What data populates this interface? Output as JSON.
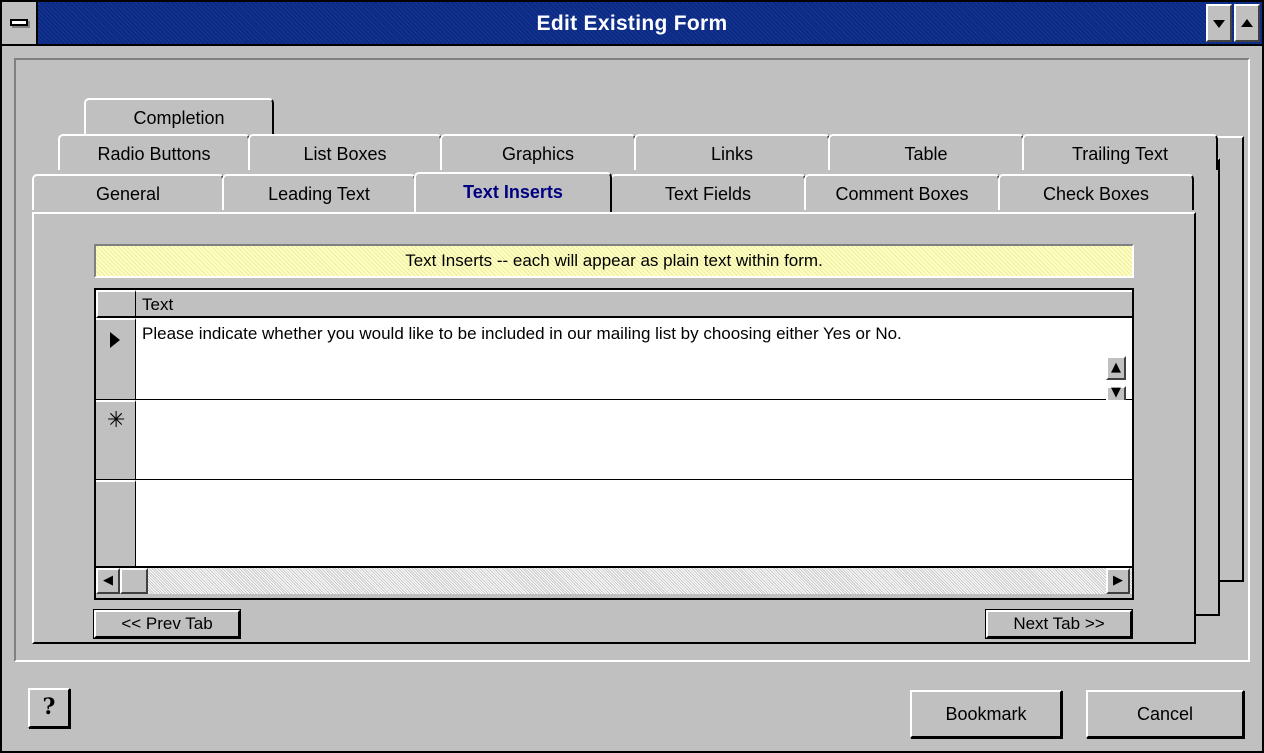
{
  "window": {
    "title": "Edit Existing Form"
  },
  "tabs": {
    "row1": [
      {
        "label": "Completion"
      }
    ],
    "row2": [
      {
        "label": "Radio Buttons"
      },
      {
        "label": "List Boxes"
      },
      {
        "label": "Graphics"
      },
      {
        "label": "Links"
      },
      {
        "label": "Table"
      },
      {
        "label": "Trailing Text"
      }
    ],
    "row3": [
      {
        "label": "General"
      },
      {
        "label": "Leading Text"
      },
      {
        "label": "Text Inserts",
        "active": true
      },
      {
        "label": "Text Fields"
      },
      {
        "label": "Comment Boxes"
      },
      {
        "label": "Check Boxes"
      }
    ]
  },
  "page": {
    "banner": "Text Inserts -- each will appear as plain text within form.",
    "grid": {
      "column_header": "Text",
      "rows": [
        {
          "marker": "current-record-icon",
          "text": "Please indicate whether you would like to be included in our mailing list by choosing either Yes or No."
        },
        {
          "marker": "new-record-icon",
          "marker_glyph": "✳",
          "text": ""
        },
        {
          "marker": "",
          "text": ""
        }
      ]
    },
    "prev_tab_label": "<< Prev Tab",
    "next_tab_label": "Next Tab >>"
  },
  "footer": {
    "help_glyph": "?",
    "bookmark_label": "Bookmark",
    "cancel_label": "Cancel"
  },
  "colors": {
    "titlebar": "#0a2a86",
    "active_tab_text": "#000080",
    "banner_bg": "#ffffc0",
    "face": "#c0c0c0"
  }
}
